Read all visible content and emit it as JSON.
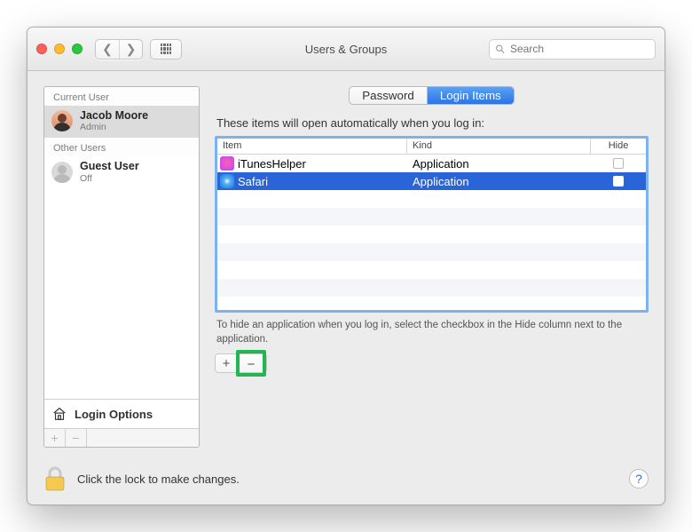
{
  "window": {
    "title": "Users & Groups"
  },
  "search": {
    "placeholder": "Search"
  },
  "sidebar": {
    "current_heading": "Current User",
    "other_heading": "Other Users",
    "current_user": {
      "name": "Jacob Moore",
      "role": "Admin"
    },
    "other_user": {
      "name": "Guest User",
      "role": "Off"
    },
    "login_options": "Login Options"
  },
  "tabs": {
    "password": "Password",
    "login_items": "Login Items"
  },
  "main": {
    "description": "These items will open automatically when you log in:",
    "columns": {
      "item": "Item",
      "kind": "Kind",
      "hide": "Hide"
    },
    "rows": [
      {
        "icon": "itunes-icon",
        "name": "iTunesHelper",
        "kind": "Application",
        "hide": false,
        "selected": false
      },
      {
        "icon": "safari-icon",
        "name": "Safari",
        "kind": "Application",
        "hide": false,
        "selected": true
      }
    ],
    "hint": "To hide an application when you log in, select the checkbox in the Hide column next to the application."
  },
  "footer": {
    "lock_text": "Click the lock to make changes."
  },
  "colors": {
    "selection": "#2964d9",
    "focus_ring": "#7BB2F2",
    "highlight": "#22b552"
  }
}
